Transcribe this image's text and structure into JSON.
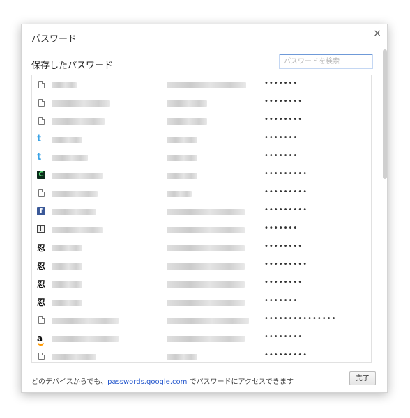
{
  "dialog": {
    "title": "パスワード",
    "close_glyph": "×",
    "section_title": "保存したパスワード",
    "search_placeholder": "パスワードを検索"
  },
  "rows": [
    {
      "icon": "file-icon",
      "password": "•••••••"
    },
    {
      "icon": "file-icon",
      "password": "••••••••"
    },
    {
      "icon": "file-icon",
      "password": "••••••••"
    },
    {
      "icon": "twitter-icon",
      "password": "•••••••"
    },
    {
      "icon": "twitter-icon",
      "password": "•••••••"
    },
    {
      "icon": "c-icon",
      "password": "•••••••••"
    },
    {
      "icon": "file-icon",
      "password": "•••••••••"
    },
    {
      "icon": "facebook-icon",
      "password": "•••••••••"
    },
    {
      "icon": "i-icon",
      "password": "•••••••"
    },
    {
      "icon": "kanji-icon",
      "password": "••••••••"
    },
    {
      "icon": "kanji-icon",
      "password": "•••••••••"
    },
    {
      "icon": "kanji-icon",
      "password": "••••••••"
    },
    {
      "icon": "kanji-icon",
      "password": "•••••••"
    },
    {
      "icon": "file-icon",
      "password": "•••••••••••••••"
    },
    {
      "icon": "amazon-icon",
      "password": "••••••••"
    },
    {
      "icon": "file-icon",
      "password": "•••••••••"
    }
  ],
  "footer": {
    "prefix": "どのデバイスからでも、",
    "link": "passwords.google.com",
    "suffix": " でパスワードにアクセスできます",
    "done_label": "完了"
  }
}
